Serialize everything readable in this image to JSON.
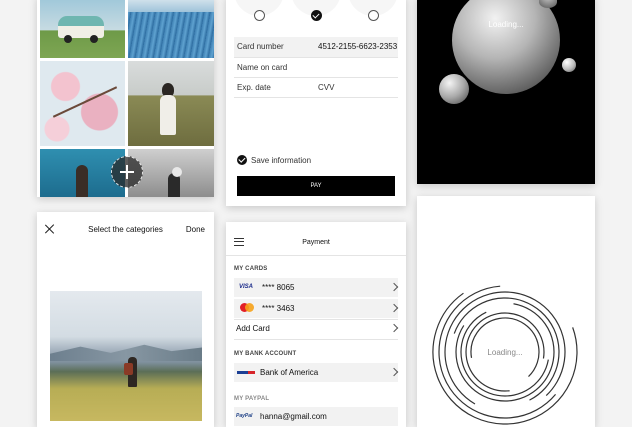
{
  "gallery": {
    "photos": [
      "van-photo",
      "field-aerial-photo",
      "cherry-blossom-photo",
      "woman-field-photo",
      "sea-woman-photo",
      "bw-woman-photo"
    ]
  },
  "payment_form": {
    "card_number_label": "Card number",
    "card_number_value": "4512-2155-6623-2353",
    "name_on_card_label": "Name on card",
    "exp_date_label": "Exp. date",
    "cvv_label": "CVV",
    "save_info_label": "Save information",
    "pay_button_label": "PAY"
  },
  "loading_dark": {
    "text": "Loading..."
  },
  "categories": {
    "title": "Select the categories",
    "done_label": "Done"
  },
  "payment_list": {
    "title": "Payment",
    "my_cards_label": "MY CARDS",
    "cards": [
      {
        "brand_icon": "visa-icon",
        "brand": "VISA",
        "number": "**** 8065"
      },
      {
        "brand_icon": "mastercard-icon",
        "brand": "",
        "number": "**** 3463"
      }
    ],
    "add_card_label": "Add Card",
    "bank_account_label": "MY BANK ACCOUNT",
    "bank_name": "Bank of America",
    "paypal_label": "MY PAYPAL",
    "paypal_brand": "PayPal",
    "paypal_email": "hanna@gmail.com"
  },
  "loading_light": {
    "text": "Loading..."
  },
  "colors": {
    "dark_bg": "#000000",
    "pay_button": "#000000",
    "row_bg": "#f2f2f2"
  }
}
